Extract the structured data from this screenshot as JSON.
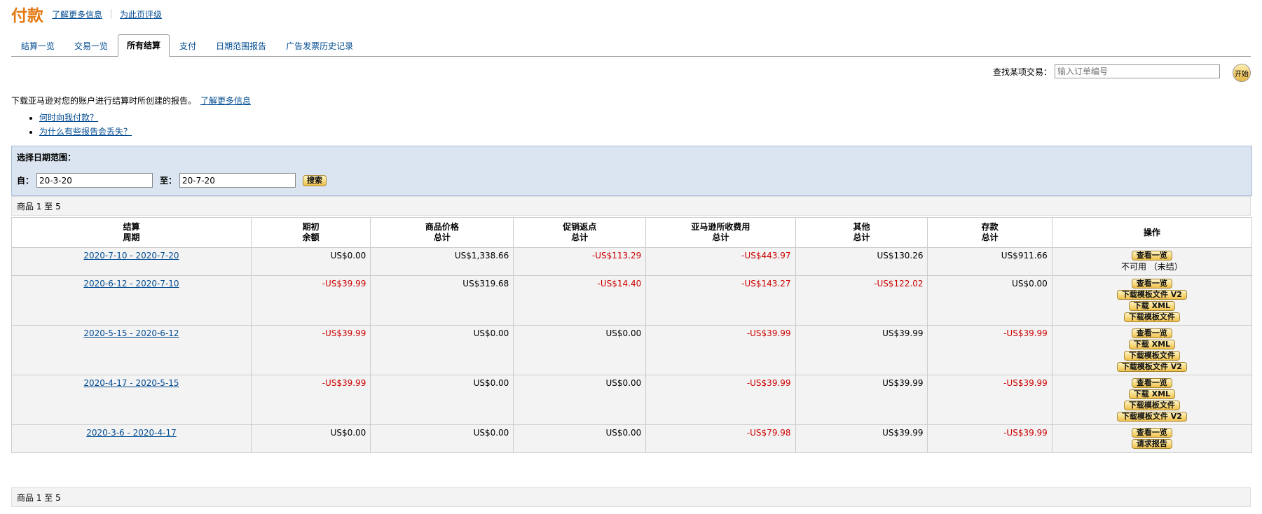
{
  "header": {
    "title": "付款",
    "learn_more": "了解更多信息",
    "rate_page": "为此页评级"
  },
  "tabs": [
    "结算一览",
    "交易一览",
    "所有结算",
    "支付",
    "日期范围报告",
    "广告发票历史记录"
  ],
  "active_tab": 2,
  "find": {
    "label": "查找某项交易：",
    "placeholder": "输入订单编号",
    "go": "开始"
  },
  "intro": {
    "text": "下载亚马逊对您的账户进行结算时所创建的报告。",
    "link": "了解更多信息"
  },
  "faq": [
    "何时向我付款？",
    "为什么有些报告会丢失？"
  ],
  "date_range": {
    "heading": "选择日期范围：",
    "from_label": "自：",
    "from_value": "20-3-20",
    "to_label": "至：",
    "to_value": "20-7-20",
    "search": "搜索"
  },
  "count_text": "商品 1 至 5",
  "columns": [
    [
      "结算",
      "周期"
    ],
    [
      "期初",
      "余额"
    ],
    [
      "商品价格",
      "总计"
    ],
    [
      "促销返点",
      "总计"
    ],
    [
      "亚马逊所收费用",
      "总计"
    ],
    [
      "其他",
      "总计"
    ],
    [
      "存款",
      "总计"
    ],
    [
      "操作",
      ""
    ]
  ],
  "rows": [
    {
      "period": "2020-7-10 - 2020-7-20",
      "cells": [
        "US$0.00",
        "US$1,338.66",
        "-US$113.29",
        "-US$443.97",
        "US$130.26",
        "US$911.66"
      ],
      "actions": [
        "查看一览"
      ],
      "note": "不可用 （未结）"
    },
    {
      "period": "2020-6-12 - 2020-7-10",
      "cells": [
        "-US$39.99",
        "US$319.68",
        "-US$14.40",
        "-US$143.27",
        "-US$122.02",
        "US$0.00"
      ],
      "actions": [
        "查看一览",
        "下载模板文件 V2",
        "下载 XML",
        "下载模板文件"
      ],
      "note": ""
    },
    {
      "period": "2020-5-15 - 2020-6-12",
      "cells": [
        "-US$39.99",
        "US$0.00",
        "US$0.00",
        "-US$39.99",
        "US$39.99",
        "-US$39.99"
      ],
      "actions": [
        "查看一览",
        "下载 XML",
        "下载模板文件",
        "下载模板文件 V2"
      ],
      "note": ""
    },
    {
      "period": "2020-4-17 - 2020-5-15",
      "cells": [
        "-US$39.99",
        "US$0.00",
        "US$0.00",
        "-US$39.99",
        "US$39.99",
        "-US$39.99"
      ],
      "actions": [
        "查看一览",
        "下载 XML",
        "下载模板文件",
        "下载模板文件 V2"
      ],
      "note": ""
    },
    {
      "period": "2020-3-6 - 2020-4-17",
      "cells": [
        "US$0.00",
        "US$0.00",
        "US$0.00",
        "-US$79.98",
        "US$39.99",
        "-US$39.99"
      ],
      "actions": [
        "查看一览",
        "请求报告"
      ],
      "note": ""
    }
  ],
  "colors": {
    "title": "#e47911",
    "link": "#004b91",
    "negative": "#cc0000",
    "date_panel": "#dbe5f1",
    "button": "#f0c14b"
  }
}
